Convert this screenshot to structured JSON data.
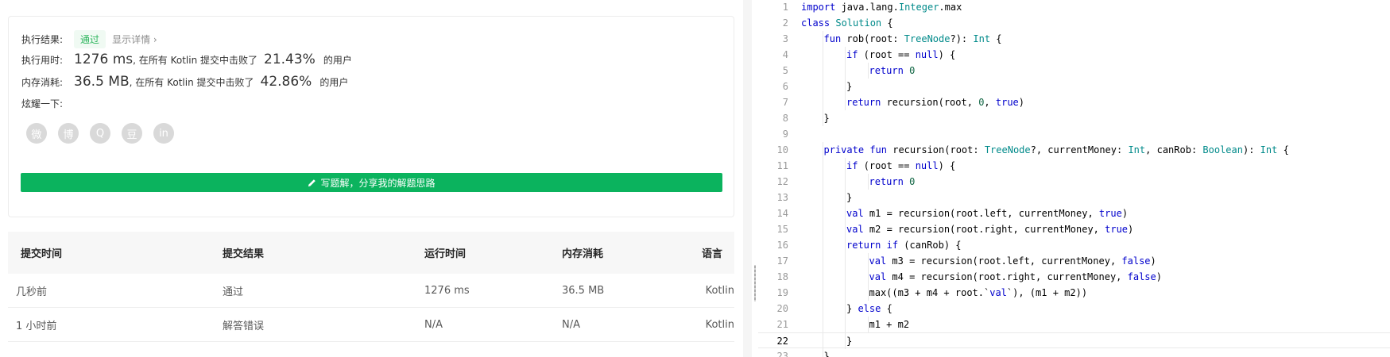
{
  "result": {
    "result_label": "执行结果:",
    "status": "通过",
    "detail_link": "显示详情 ›",
    "runtime_label": "执行用时:",
    "runtime_value": "1276 ms",
    "runtime_mid": ", 在所有 Kotlin 提交中击败了",
    "runtime_pct": "21.43%",
    "users_suffix": "的用户",
    "memory_label": "内存消耗:",
    "memory_value": "36.5 MB",
    "memory_mid": ", 在所有 Kotlin 提交中击败了",
    "memory_pct": "42.86%",
    "share_label": "炫耀一下:",
    "share_icons": [
      "wechat-icon",
      "weibo-icon",
      "qq-icon",
      "douban-icon",
      "linkedin-icon"
    ],
    "share_glyphs": [
      "微",
      "博",
      "Q",
      "豆",
      "in"
    ],
    "write_button": "写题解，分享我的解题思路"
  },
  "submissions": {
    "headers": [
      "提交时间",
      "提交结果",
      "运行时间",
      "内存消耗",
      "语言"
    ],
    "rows": [
      {
        "time": "几秒前",
        "status": "通过",
        "runtime": "1276 ms",
        "memory": "36.5 MB",
        "lang": "Kotlin"
      },
      {
        "time": "1 小时前",
        "status": "解答错误",
        "runtime": "N/A",
        "memory": "N/A",
        "lang": "Kotlin"
      }
    ]
  },
  "editor": {
    "active_line": 22,
    "lines": [
      {
        "n": "1",
        "indent": 0,
        "tokens": [
          [
            "kw",
            "import"
          ],
          [
            "t",
            " java.lang."
          ],
          [
            "ty",
            "Integer"
          ],
          [
            "t",
            ".max"
          ]
        ]
      },
      {
        "n": "2",
        "indent": 0,
        "tokens": [
          [
            "kw",
            "class"
          ],
          [
            "t",
            " "
          ],
          [
            "ty",
            "Solution"
          ],
          [
            "t",
            " {"
          ]
        ]
      },
      {
        "n": "3",
        "indent": 1,
        "tokens": [
          [
            "kw",
            "fun"
          ],
          [
            "t",
            " rob(root: "
          ],
          [
            "ty",
            "TreeNode"
          ],
          [
            "t",
            "?): "
          ],
          [
            "ty",
            "Int"
          ],
          [
            "t",
            " {"
          ]
        ]
      },
      {
        "n": "4",
        "indent": 2,
        "tokens": [
          [
            "kw",
            "if"
          ],
          [
            "t",
            " (root == "
          ],
          [
            "kw",
            "null"
          ],
          [
            "t",
            ") {"
          ]
        ]
      },
      {
        "n": "5",
        "indent": 3,
        "tokens": [
          [
            "kw",
            "return"
          ],
          [
            "t",
            " "
          ],
          [
            "num",
            "0"
          ]
        ]
      },
      {
        "n": "6",
        "indent": 2,
        "tokens": [
          [
            "t",
            "}"
          ]
        ]
      },
      {
        "n": "7",
        "indent": 2,
        "tokens": [
          [
            "kw",
            "return"
          ],
          [
            "t",
            " recursion(root, "
          ],
          [
            "num",
            "0"
          ],
          [
            "t",
            ", "
          ],
          [
            "kw",
            "true"
          ],
          [
            "t",
            ")"
          ]
        ]
      },
      {
        "n": "8",
        "indent": 1,
        "tokens": [
          [
            "t",
            "}"
          ]
        ]
      },
      {
        "n": "9",
        "indent": 0,
        "tokens": []
      },
      {
        "n": "10",
        "indent": 1,
        "tokens": [
          [
            "kw",
            "private"
          ],
          [
            "t",
            " "
          ],
          [
            "kw",
            "fun"
          ],
          [
            "t",
            " recursion(root: "
          ],
          [
            "ty",
            "TreeNode"
          ],
          [
            "t",
            "?, currentMoney: "
          ],
          [
            "ty",
            "Int"
          ],
          [
            "t",
            ", canRob: "
          ],
          [
            "ty",
            "Boolean"
          ],
          [
            "t",
            "): "
          ],
          [
            "ty",
            "Int"
          ],
          [
            "t",
            " {"
          ]
        ]
      },
      {
        "n": "11",
        "indent": 2,
        "tokens": [
          [
            "kw",
            "if"
          ],
          [
            "t",
            " (root == "
          ],
          [
            "kw",
            "null"
          ],
          [
            "t",
            ") {"
          ]
        ]
      },
      {
        "n": "12",
        "indent": 3,
        "tokens": [
          [
            "kw",
            "return"
          ],
          [
            "t",
            " "
          ],
          [
            "num",
            "0"
          ]
        ]
      },
      {
        "n": "13",
        "indent": 2,
        "tokens": [
          [
            "t",
            "}"
          ]
        ]
      },
      {
        "n": "14",
        "indent": 2,
        "tokens": [
          [
            "kw",
            "val"
          ],
          [
            "t",
            " m1 = recursion(root.left, currentMoney, "
          ],
          [
            "kw",
            "true"
          ],
          [
            "t",
            ")"
          ]
        ]
      },
      {
        "n": "15",
        "indent": 2,
        "tokens": [
          [
            "kw",
            "val"
          ],
          [
            "t",
            " m2 = recursion(root.right, currentMoney, "
          ],
          [
            "kw",
            "true"
          ],
          [
            "t",
            ")"
          ]
        ]
      },
      {
        "n": "16",
        "indent": 2,
        "tokens": [
          [
            "kw",
            "return"
          ],
          [
            "t",
            " "
          ],
          [
            "kw",
            "if"
          ],
          [
            "t",
            " (canRob) {"
          ]
        ]
      },
      {
        "n": "17",
        "indent": 3,
        "tokens": [
          [
            "kw",
            "val"
          ],
          [
            "t",
            " m3 = recursion(root.left, currentMoney, "
          ],
          [
            "kw",
            "false"
          ],
          [
            "t",
            ")"
          ]
        ]
      },
      {
        "n": "18",
        "indent": 3,
        "tokens": [
          [
            "kw",
            "val"
          ],
          [
            "t",
            " m4 = recursion(root.right, currentMoney, "
          ],
          [
            "kw",
            "false"
          ],
          [
            "t",
            ")"
          ]
        ]
      },
      {
        "n": "19",
        "indent": 3,
        "tokens": [
          [
            "t",
            "max((m3 + m4 + root.`"
          ],
          [
            "kw",
            "val"
          ],
          [
            "t",
            "`), (m1 + m2))"
          ]
        ]
      },
      {
        "n": "20",
        "indent": 2,
        "tokens": [
          [
            "t",
            "} "
          ],
          [
            "kw",
            "else"
          ],
          [
            "t",
            " {"
          ]
        ]
      },
      {
        "n": "21",
        "indent": 3,
        "tokens": [
          [
            "t",
            "m1 + m2"
          ]
        ]
      },
      {
        "n": "22",
        "indent": 2,
        "tokens": [
          [
            "t",
            "}"
          ]
        ]
      },
      {
        "n": "23",
        "indent": 1,
        "tokens": [
          [
            "t",
            "}"
          ]
        ]
      }
    ]
  },
  "colors": {
    "accent": "#0bb35e",
    "pass": "#2db55d",
    "error": "#ef4743",
    "keyword": "#0000cc",
    "type": "#008a8a",
    "number": "#116644"
  }
}
